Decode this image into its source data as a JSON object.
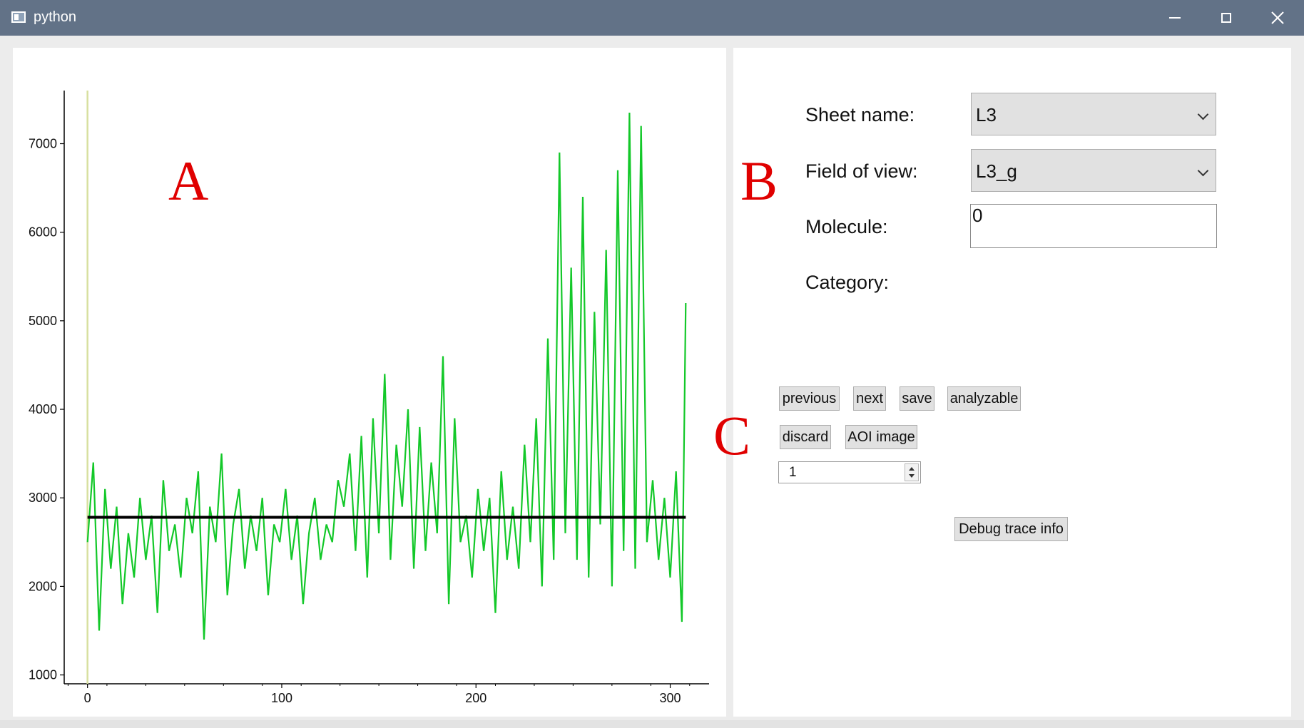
{
  "window": {
    "title": "python",
    "controls": [
      "minimize",
      "maximize",
      "close"
    ]
  },
  "annotations": {
    "a": "A",
    "b": "B",
    "c": "C"
  },
  "form": {
    "sheet_name_label": "Sheet name:",
    "sheet_name_value": "L3",
    "field_of_view_label": "Field of view:",
    "field_of_view_value": "L3_g",
    "molecule_label": "Molecule:",
    "molecule_value": "0",
    "category_label": "Category:"
  },
  "buttons": {
    "previous": "previous",
    "next": "next",
    "save": "save",
    "analyzable": "analyzable",
    "discard": "discard",
    "aoi_image": "AOI image",
    "debug": "Debug trace info"
  },
  "spinbox": {
    "value": "1"
  },
  "colors": {
    "trace": "#13c829",
    "mean_line": "#000000",
    "vertical_marker": "#d8e0a0",
    "titlebar": "#627287",
    "annotation": "#e00000"
  },
  "chart_data": {
    "type": "line",
    "xlim": [
      -12,
      320
    ],
    "ylim": [
      900,
      7600
    ],
    "x_ticks": [
      0,
      100,
      200,
      300
    ],
    "y_ticks": [
      1000,
      2000,
      3000,
      4000,
      5000,
      6000,
      7000
    ],
    "mean_value": 2780,
    "marker_x": 0,
    "x": [
      0,
      3,
      6,
      9,
      12,
      15,
      18,
      21,
      24,
      27,
      30,
      33,
      36,
      39,
      42,
      45,
      48,
      51,
      54,
      57,
      60,
      63,
      66,
      69,
      72,
      75,
      78,
      81,
      84,
      87,
      90,
      93,
      96,
      99,
      102,
      105,
      108,
      111,
      114,
      117,
      120,
      123,
      126,
      129,
      132,
      135,
      138,
      141,
      144,
      147,
      150,
      153,
      156,
      159,
      162,
      165,
      168,
      171,
      174,
      177,
      180,
      183,
      186,
      189,
      192,
      195,
      198,
      201,
      204,
      207,
      210,
      213,
      216,
      219,
      222,
      225,
      228,
      231,
      234,
      237,
      240,
      243,
      246,
      249,
      252,
      255,
      258,
      261,
      264,
      267,
      270,
      273,
      276,
      279,
      282,
      285,
      288,
      291,
      294,
      297,
      300,
      303,
      306,
      308
    ],
    "series": [
      {
        "values": [
          2500,
          3400,
          1500,
          3100,
          2200,
          2900,
          1800,
          2600,
          2100,
          3000,
          2300,
          2800,
          1700,
          3200,
          2400,
          2700,
          2100,
          3000,
          2600,
          3300,
          1400,
          2900,
          2500,
          3500,
          1900,
          2700,
          3100,
          2200,
          2800,
          2400,
          3000,
          1900,
          2700,
          2500,
          3100,
          2300,
          2800,
          1800,
          2600,
          3000,
          2300,
          2700,
          2500,
          3200,
          2900,
          3500,
          2400,
          3700,
          2100,
          3900,
          2600,
          4400,
          2300,
          3600,
          2900,
          4000,
          2200,
          3800,
          2400,
          3400,
          2600,
          4600,
          1800,
          3900,
          2500,
          2800,
          2100,
          3100,
          2400,
          3000,
          1700,
          3300,
          2300,
          2900,
          2200,
          3600,
          2500,
          3900,
          2000,
          4800,
          2300,
          6900,
          2600,
          5600,
          2300,
          6400,
          2100,
          5100,
          2700,
          5800,
          2000,
          6700,
          2400,
          7350,
          2200,
          7200,
          2500,
          3200,
          2300,
          3000,
          2100,
          3300,
          1600,
          5200
        ]
      }
    ]
  }
}
